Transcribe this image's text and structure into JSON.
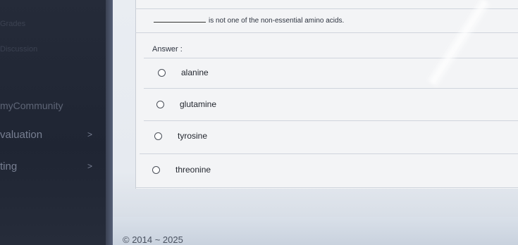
{
  "sidebar": {
    "items": [
      {
        "label": "Grades",
        "style": "faint"
      },
      {
        "label": "Discussion",
        "style": "faint"
      },
      {
        "label": "myCommunity",
        "style": "normal"
      },
      {
        "label": "valuation",
        "style": "big",
        "chevron": ">"
      },
      {
        "label": "ting",
        "style": "big",
        "chevron": ">"
      }
    ]
  },
  "question": {
    "text": "is not one of the non-essential amino acids."
  },
  "answer_label": "Answer :",
  "options": [
    {
      "label": "alanine",
      "selected": false
    },
    {
      "label": "glutamine",
      "selected": false
    },
    {
      "label": "tyrosine",
      "selected": false
    },
    {
      "label": "threonine",
      "selected": false
    }
  ],
  "footer": {
    "copyright": "© 2014 ~ 2025"
  },
  "colors": {
    "sidebar_bg": "#1f2533",
    "content_bg": "#e9edf2",
    "text": "#23272f"
  }
}
